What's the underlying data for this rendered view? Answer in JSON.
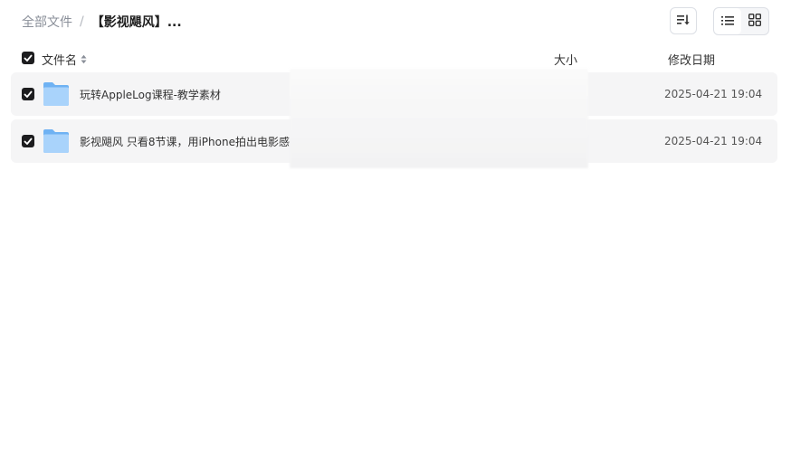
{
  "breadcrumb": {
    "root": "全部文件",
    "separator": "/",
    "current": "【影视飓风】..."
  },
  "toolbar": {
    "sort_icon": "sort-list-icon",
    "views": [
      {
        "icon": "list-view-icon",
        "active": true
      },
      {
        "icon": "grid-view-icon",
        "active": false
      }
    ]
  },
  "columns": {
    "name": "文件名",
    "size": "大小",
    "date": "修改日期"
  },
  "files": [
    {
      "name": "玩转AppleLog课程-教学素材",
      "size": "",
      "date": "2025-04-21 19:04",
      "type": "folder",
      "checked": true
    },
    {
      "name": "影视飓风 只看8节课，用iPhone拍出电影感",
      "size": "",
      "date": "2025-04-21 19:04",
      "type": "folder",
      "checked": true
    }
  ],
  "colors": {
    "checkbox": "#1d1d1f",
    "row_bg": "#f5f5f6",
    "folder_light": "#a9d3fb",
    "folder_dark": "#6fb2f3"
  }
}
